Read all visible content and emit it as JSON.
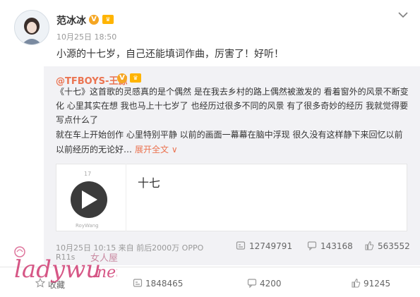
{
  "post": {
    "author": "范冰冰",
    "verified_badge": "V",
    "crown_badge": "♛",
    "time": "10月25日 18:50",
    "text": "小源的十七岁，自己还能填词作曲，厉害了！好听！",
    "menu_icon": "chevron-down"
  },
  "repost": {
    "user": "@TFBOYS-王源",
    "verified_badge": "V",
    "crown_badge": "♛",
    "lines": [
      "《十七》这首歌的灵感真的是个偶然 是在我去乡村的路上偶然被激发的 看着窗外的风景不断变",
      "化 心里其实在想 我也马上十七岁了 也经历过很多不同的风景 有了很多奇妙的经历 我就觉得要",
      "写点什么了",
      "就在车上开始创作 心里特别平静 以前的画面一幕幕在脑中浮现 很久没有这样静下来回忆以前",
      "以前经历的无论好…"
    ],
    "expand_label": "展开全文 ∨",
    "card": {
      "title": "十七",
      "cover_label": "17",
      "cover_sub": "RoyWang"
    },
    "time_line1": "10月25日 10:15 来自 前后2000万 OPPO",
    "time_line2": "R11s",
    "reposts": "12749791",
    "comments": "143168",
    "likes": "563552"
  },
  "actions": {
    "favorite": "收藏",
    "repost": "1848465",
    "comment": "4200",
    "like": "91245"
  },
  "watermark": {
    "logo": "ladywu.net",
    "cn": "女人屋"
  },
  "colors": {
    "accent": "#eb7350",
    "repost_bg": "#f2f2f5",
    "watermark": "#d03a72"
  }
}
